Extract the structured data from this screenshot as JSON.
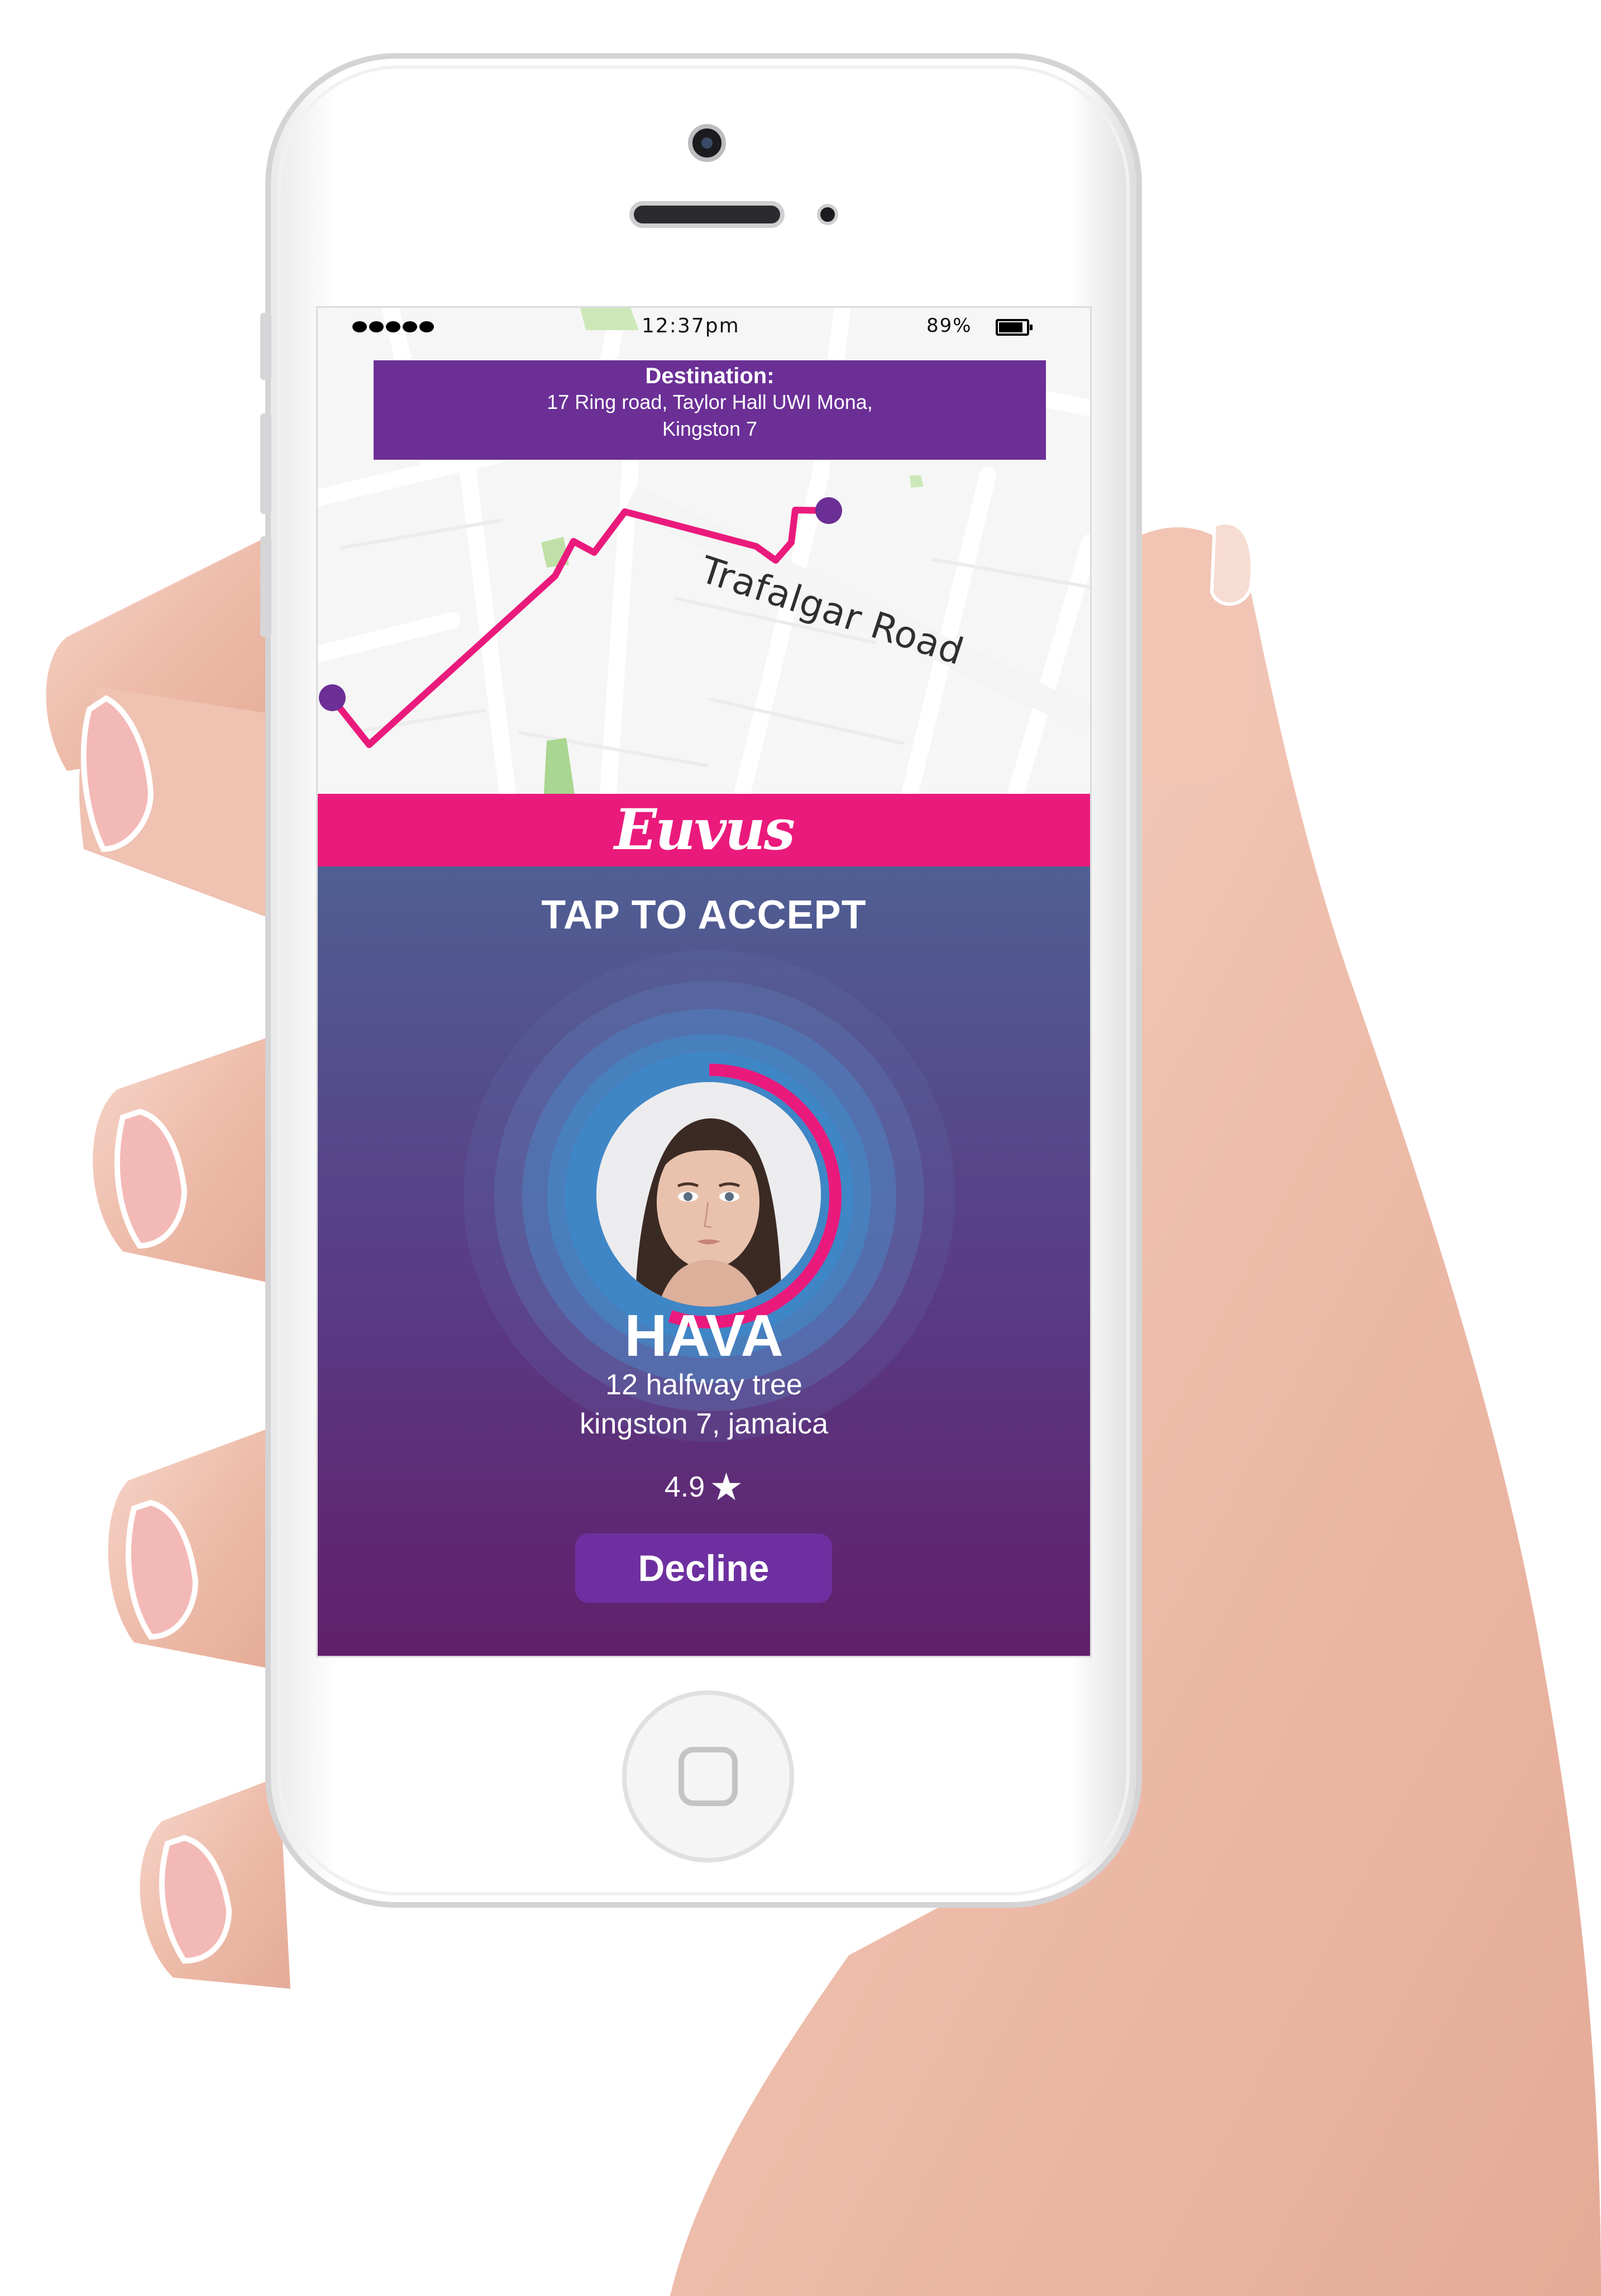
{
  "status_bar": {
    "time": "12:37pm",
    "battery_percent": "89%",
    "signal_dots": 5
  },
  "destination": {
    "title": "Destination:",
    "line1": "17 Ring road, Taylor Hall UWI Mona,",
    "line2": "Kingston 7"
  },
  "map": {
    "road_label": "Trafalgar Road",
    "route_color": "#ea1a7c",
    "endpoint_color": "#6b2f96"
  },
  "brand": {
    "name": "Euvus",
    "color": "#ea1a7c"
  },
  "request": {
    "prompt": "TAP TO ACCEPT",
    "rider_name": "HAVA",
    "address_line1": "12 halfway tree",
    "address_line2": "kingston 7, jamaica",
    "rating": "4.9",
    "rating_icon": "star-icon",
    "timer_progress": 0.55,
    "decline_label": "Decline"
  }
}
